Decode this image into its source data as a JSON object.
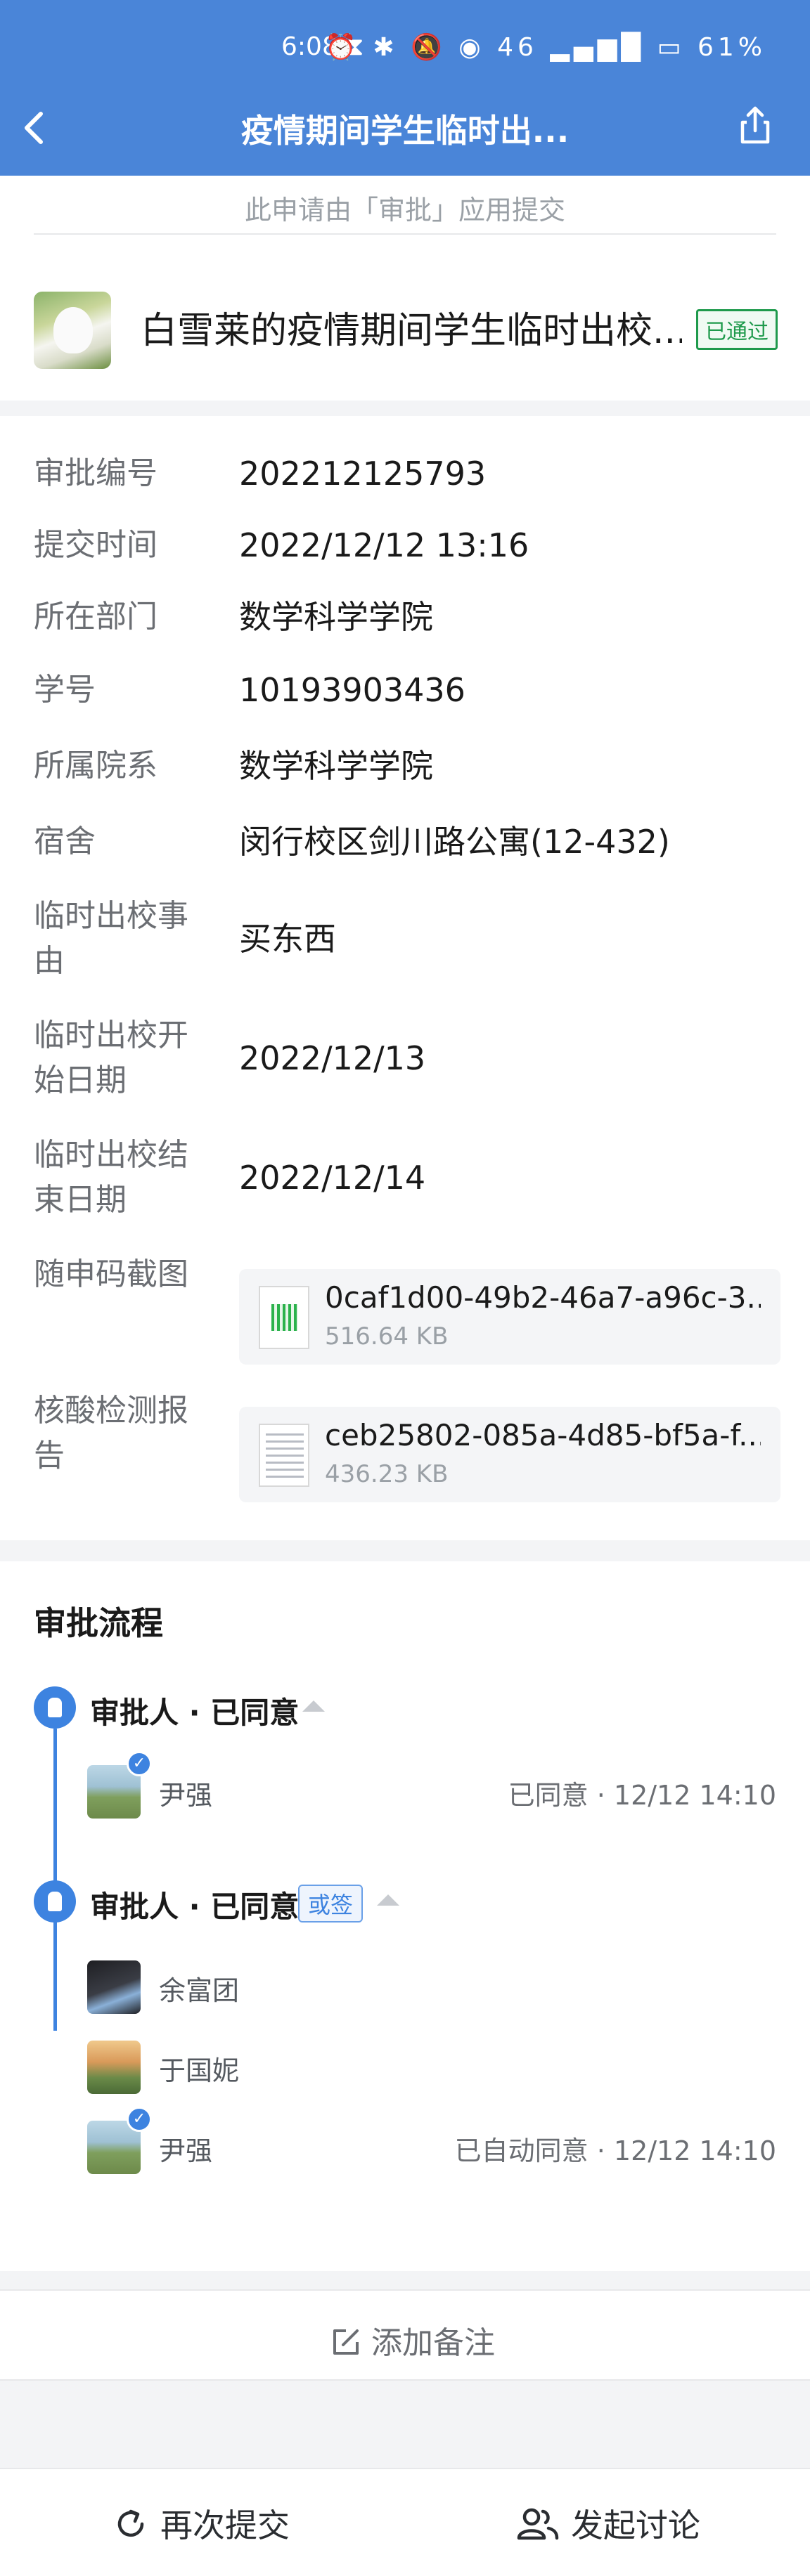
{
  "status_bar": {
    "time": "6:08 ⧗",
    "icons": "⏰ ✱ 🔕 ◉ 46 ▂▄▆█ ▭ 61%"
  },
  "nav": {
    "title": "疫情期间学生临时出..."
  },
  "summary": {
    "source_note": "此申请由「审批」应用提交",
    "title": "白雪莱的疫情期间学生临时出校...",
    "status_badge": "已通过"
  },
  "details": {
    "rows": [
      {
        "label": "审批编号",
        "value": "202212125793"
      },
      {
        "label": "提交时间",
        "value": "2022/12/12 13:16"
      },
      {
        "label": "所在部门",
        "value": "数学科学学院"
      },
      {
        "label": "学号",
        "value": "10193903436"
      },
      {
        "label": "所属院系",
        "value": "数学科学学院"
      },
      {
        "label": "宿舍",
        "value": "闵行校区剑川路公寓(12-432)"
      },
      {
        "label_line1": "临时出校事",
        "label_line2": "由",
        "value": "买东西"
      },
      {
        "label_line1": "临时出校开",
        "label_line2": "始日期",
        "value": "2022/12/13"
      },
      {
        "label_line1": "临时出校结",
        "label_line2": "束日期",
        "value": "2022/12/14"
      }
    ],
    "files": [
      {
        "label": "随申码截图",
        "name": "0caf1d00-49b2-46a7-a96c-3...",
        "size": "516.64 KB"
      },
      {
        "label_line1": "核酸检测报",
        "label_line2": "告",
        "name": "ceb25802-085a-4d85-bf5a-f...",
        "size": "436.23 KB"
      }
    ]
  },
  "flow": {
    "title": "审批流程",
    "steps": [
      {
        "title": "审批人 · 已同意",
        "people": [
          {
            "name": "尹强",
            "status": "已同意 · 12/12 14:10"
          }
        ]
      },
      {
        "title": "审批人 · 已同意",
        "tag": "或签",
        "people": [
          {
            "name": "余富团"
          },
          {
            "name": "于国妮"
          },
          {
            "name": "尹强",
            "status": "已自动同意 · 12/12 14:10"
          }
        ]
      }
    ]
  },
  "add_note": {
    "label": "添加备注"
  },
  "bottom": {
    "resubmit": "再次提交",
    "discuss": "发起讨论"
  },
  "colors": {
    "header": "#4a85d8",
    "accent": "#3d83e0",
    "approved": "#1f9a4c"
  }
}
